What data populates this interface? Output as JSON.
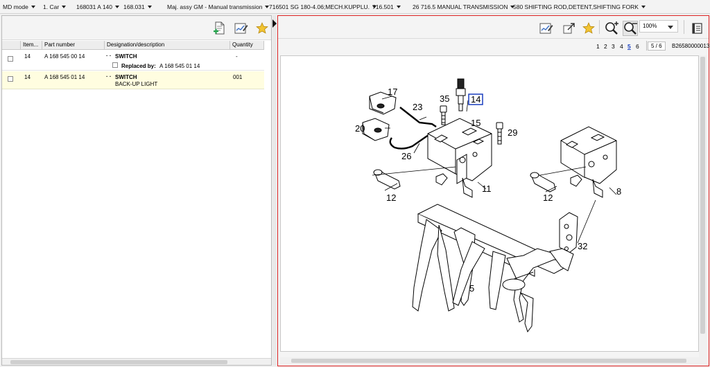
{
  "breadcrumb": [
    {
      "label": "MD mode"
    },
    {
      "label": "1. Car"
    },
    {
      "label": "168031 A 140"
    },
    {
      "label": "168.031"
    },
    {
      "label": "Maj. assy GM - Manual transmission"
    },
    {
      "label": "716501 SG 180-4.06;MECH.KUPPLU."
    },
    {
      "label": "716.501"
    },
    {
      "label": "26 716.5  MANUAL TRANSMISSION"
    },
    {
      "label": "580 SHIFTING ROD,DETENT,SHIFTING FORK"
    }
  ],
  "parts_list": {
    "columns": [
      "Item...",
      "Part number",
      "Designation/description",
      "Quantity"
    ],
    "rows": [
      {
        "item": "14",
        "part_number": "A 168 545 00 14",
        "dots": "· ·",
        "designation": "SWITCH",
        "quantity": "-",
        "replaced_label": "Replaced by:",
        "replaced_value": "A 168 545 01 14",
        "highlighted": false
      },
      {
        "item": "14",
        "part_number": "A 168 545 01 14",
        "dots": "· ·",
        "designation": "SWITCH",
        "subdescription": "BACK-UP LIGHT",
        "quantity": "001",
        "highlighted": true
      }
    ]
  },
  "toolbar": {
    "zoom_value": "100%"
  },
  "pager": {
    "pages": [
      "1",
      "2",
      "3",
      "4",
      "5",
      "6"
    ],
    "current_page": "5",
    "page_count_text": "5 / 6",
    "drawing_id": "B26580000013"
  },
  "drawing_labels": {
    "p17": "17",
    "p23": "23",
    "p35": "35",
    "p14": "14",
    "p15": "15",
    "p20": "20",
    "p29": "29",
    "p26": "26",
    "p12a": "12",
    "p11": "11",
    "p12b": "12",
    "p8": "8",
    "p32": "32",
    "p5": "5"
  },
  "colors": {
    "accent": "#dd2222",
    "highlight_row": "#fffde0",
    "link": "#1a3fbf"
  }
}
